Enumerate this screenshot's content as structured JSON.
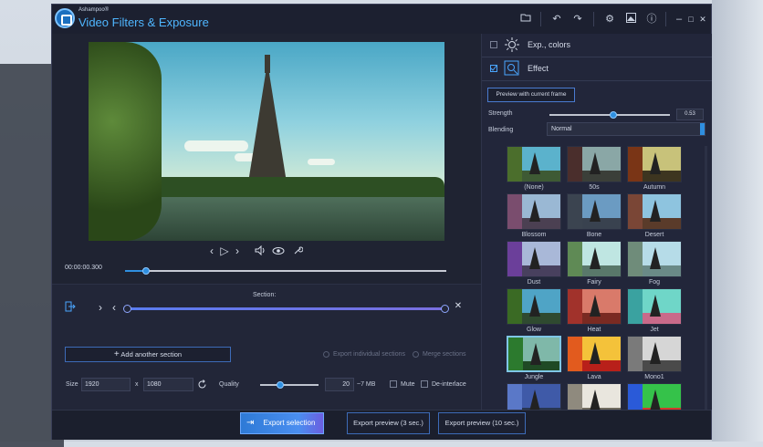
{
  "app": {
    "brand": "Ashampoo®",
    "title": "Video Filters & Exposure"
  },
  "toolbar": {
    "folder_icon": "folder-icon",
    "undo": "↶",
    "redo": "↷",
    "settings": "⚙",
    "info": "ⓘ",
    "minimize": "–",
    "maximize": "□",
    "close": "✕"
  },
  "player": {
    "timecode": "00:00:00.300",
    "progress_fraction": 0.065,
    "prev": "‹",
    "play": "▷",
    "next": "›"
  },
  "section": {
    "title": "Section:",
    "add_label": "Add another section",
    "add_icon": "+",
    "export_individual": "Export individual sections",
    "merge": "Merge sections"
  },
  "settings": {
    "size_label": "Size",
    "width": "1920",
    "x_label": "x",
    "height": "1080",
    "quality_label": "Quality",
    "quality_value": "20",
    "size_estimate": "~7 MB",
    "mute_label": "Mute",
    "deinterlace_label": "De-interlace",
    "quality_fraction": 0.35
  },
  "bottom": {
    "export_selection": "Export selection",
    "export_preview_3": "Export preview (3 sec.)",
    "export_preview_10": "Export preview (10 sec.)"
  },
  "panel": {
    "exp_colors": "Exp., colors",
    "effect": "Effect",
    "preview_btn": "Preview with current frame",
    "strength_label": "Strength",
    "strength_value": "0.53",
    "strength_fraction": 0.53,
    "blending_label": "Blending",
    "blending_value": "Normal"
  },
  "effects": [
    {
      "name": "(None)",
      "sky": "#5bb2cc",
      "gnd": "#3e5a34",
      "tree": "#4b6e2c"
    },
    {
      "name": "50s",
      "sky": "#8aa7a6",
      "gnd": "#3b3f39",
      "tree": "#4a2e2c"
    },
    {
      "name": "Autumn",
      "sky": "#c8c27a",
      "gnd": "#3d3520",
      "tree": "#7a3516"
    },
    {
      "name": "Blossom",
      "sky": "#9ab8d4",
      "gnd": "#4b4052",
      "tree": "#7a4d6e"
    },
    {
      "name": "Bone",
      "sky": "#6b9bc2",
      "gnd": "#39424f",
      "tree": "#3b4450"
    },
    {
      "name": "Desert",
      "sky": "#8ec4df",
      "gnd": "#5a3b2a",
      "tree": "#7a4636"
    },
    {
      "name": "Dust",
      "sky": "#a9b8d8",
      "gnd": "#48405e",
      "tree": "#6b3f9a"
    },
    {
      "name": "Fairy",
      "sky": "#bfe6e2",
      "gnd": "#59786a",
      "tree": "#5f8a55"
    },
    {
      "name": "Fog",
      "sky": "#b6dce8",
      "gnd": "#6a8a87",
      "tree": "#6f8c7a"
    },
    {
      "name": "Glow",
      "sky": "#4fa4c6",
      "gnd": "#2f4a30",
      "tree": "#3a6a24"
    },
    {
      "name": "Heat",
      "sky": "#d97a6a",
      "gnd": "#7a2a22",
      "tree": "#a1322b"
    },
    {
      "name": "Jet",
      "sky": "#6fd6c8",
      "gnd": "#c96a8a",
      "tree": "#3aa2a0"
    },
    {
      "name": "Jungle",
      "sky": "#7fb8a9",
      "gnd": "#1f4a25",
      "tree": "#2c7a2e"
    },
    {
      "name": "Lava",
      "sky": "#f4c23a",
      "gnd": "#b8201a",
      "tree": "#e25b1e"
    },
    {
      "name": "Mono1",
      "sky": "#d6d6d6",
      "gnd": "#4a4a4a",
      "tree": "#7a7a7a"
    },
    {
      "name": "",
      "sky": "#3f5aa8",
      "gnd": "#283650",
      "tree": "#5a78c8"
    },
    {
      "name": "",
      "sky": "#e9e6de",
      "gnd": "#6f6a5e",
      "tree": "#8f8a7e"
    },
    {
      "name": "",
      "sky": "#35c24a",
      "gnd": "#d23a2a",
      "tree": "#2a5ad8"
    }
  ],
  "effects_selected": "Jungle"
}
